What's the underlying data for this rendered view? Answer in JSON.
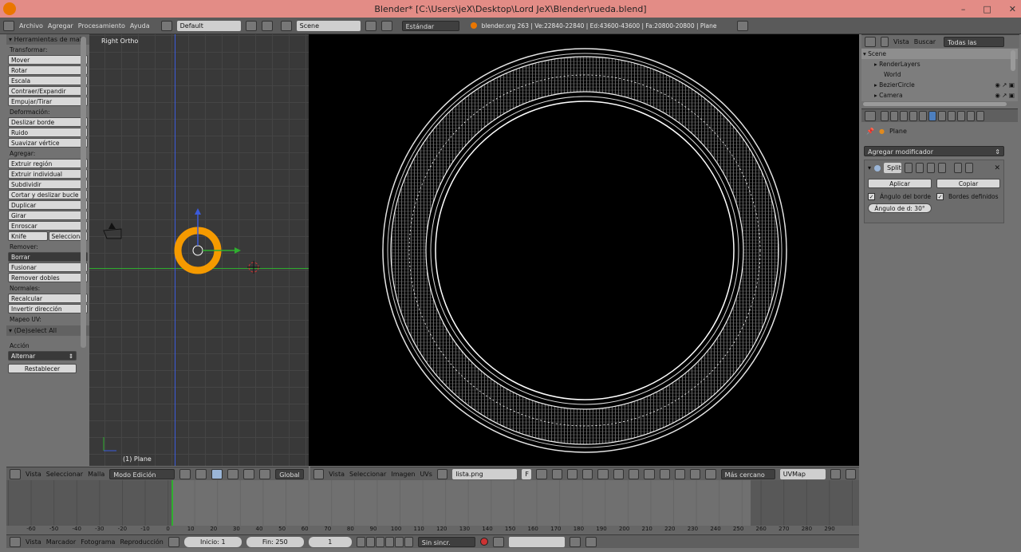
{
  "window": {
    "title": "Blender* [C:\\Users\\jeX\\Desktop\\Lord JeX\\Blender\\rueda.blend]"
  },
  "infobar": {
    "menus": [
      "Archivo",
      "Agregar",
      "Procesamiento",
      "Ayuda"
    ],
    "screen_layout": "Default",
    "scene": "Scene",
    "render_engine": "Estándar",
    "stats": "blender.org 263 | Ve:22840-22840 | Ed:43600-43600 | Fa:20800-20800 | Plane"
  },
  "toolshelf": {
    "header": "Herramientas de mall",
    "sections": [
      {
        "label": "Transformar:",
        "buttons": [
          "Mover",
          "Rotar",
          "Escala",
          "Contraer/Expandir",
          "Empujar/Tirar"
        ]
      },
      {
        "label": "Deformación:",
        "buttons": [
          "Deslizar borde",
          "Ruido",
          "Suavizar vértice"
        ]
      },
      {
        "label": "Agregar:",
        "buttons": [
          "Extruir región",
          "Extruir individual",
          "Subdividir",
          "Cortar y deslizar bucle",
          "Duplicar",
          "Girar",
          "Enroscar"
        ]
      },
      {
        "label": "Remover:",
        "buttons": [
          "Fusionar",
          "Remover dobles"
        ]
      },
      {
        "label": "Normales:",
        "buttons": [
          "Recalcular",
          "Invertir dirección"
        ]
      }
    ],
    "knife": "Knife",
    "select": "Seleccionar",
    "borrar": "Borrar",
    "uv_label": "Mapeo UV:",
    "deselect_header": "(De)select All",
    "accion_label": "Acción",
    "accion_value": "Alternar",
    "reset": "Restablecer"
  },
  "viewport": {
    "view_name": "Right Ortho",
    "object_name": "(1) Plane"
  },
  "outliner": {
    "menus": [
      "Vista",
      "Buscar"
    ],
    "filter": "Todas las escenas",
    "items": [
      "Scene",
      "RenderLayers",
      "World",
      "BezierCircle",
      "Camera"
    ]
  },
  "properties": {
    "context_object": "Plane",
    "add_modifier": "Agregar modificador",
    "modifier_name": "Split",
    "apply": "Aplicar",
    "copy": "Copiar",
    "edge_angle": "Ángulo del borde",
    "sharp_edges": "Bordes definidos",
    "split_angle": "Ángulo de d: 30°"
  },
  "view3d_header": {
    "menus": [
      "Vista",
      "Seleccionar",
      "Malla"
    ],
    "mode": "Modo Edición",
    "orientation": "Global"
  },
  "uv_header": {
    "menus": [
      "Vista",
      "Seleccionar",
      "Imagen",
      "UVs"
    ],
    "image": "lista.png",
    "image_f": "F",
    "sampling": "Más cercano",
    "uvmap": "UVMap"
  },
  "timeline": {
    "ticks": [
      "-60",
      "-50",
      "-40",
      "-30",
      "-20",
      "-10",
      "0",
      "10",
      "20",
      "30",
      "40",
      "50",
      "60",
      "70",
      "80",
      "90",
      "100",
      "110",
      "120",
      "130",
      "140",
      "150",
      "160",
      "170",
      "180",
      "190",
      "200",
      "210",
      "220",
      "230",
      "240",
      "250",
      "260",
      "270",
      "280",
      "290"
    ],
    "current_frame": 1,
    "start": 1,
    "end": 250
  },
  "timeline_header": {
    "menus": [
      "Vista",
      "Marcador",
      "Fotograma",
      "Reproducción"
    ],
    "start_label": "Inicio: 1",
    "end_label": "Fin: 250",
    "frame": "1",
    "sync": "Sin sincr."
  },
  "colors": {
    "selection_orange": "#f59a00",
    "x_axis_green": "#2fae2f",
    "z_axis_blue": "#3b5bdb"
  }
}
